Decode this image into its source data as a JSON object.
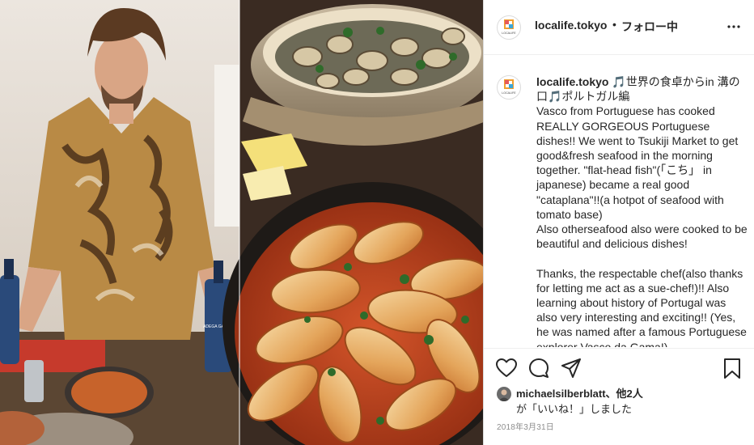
{
  "post": {
    "username": "localife.tokyo",
    "separator": "•",
    "follow_status": "フォロー中",
    "avatar_text": "LOCALIFE",
    "caption_title": "🎵世界の食卓からin 溝の口🎵ポルトガル編",
    "caption_body": "Vasco from Portuguese has cooked REALLY GORGEOUS Portuguese dishes!! We went to Tsukiji Market to get good&fresh seafood in the morning together. \"flat-head fish\"(「こち」 in japanese) became a real good \"cataplana\"!!(a hotpot of seafood with tomato base)\nAlso otherseafood also were cooked to be beautiful and delicious dishes!\n\nThanks, the respectable chef(also thanks for letting me act as a sue-chef!)!! Also learning about history of Portugal was also very interesting and exciting!! (Yes, he was named after a famous Portuguese explorer Vasco da Gama!)",
    "likes_user": "michaelsilberblatt",
    "likes_others": "、他2人",
    "likes_suffix": "が「いいね！」しました",
    "date": "2018年3月31日",
    "bottle_label": "ADEGA GARCIA"
  },
  "icons": {
    "more": "more-options-icon",
    "like": "heart-icon",
    "comment": "comment-icon",
    "share": "share-icon",
    "save": "bookmark-icon"
  },
  "colors": {
    "text": "#262626",
    "muted": "#8e8e8e",
    "border": "#dbdbdb"
  }
}
